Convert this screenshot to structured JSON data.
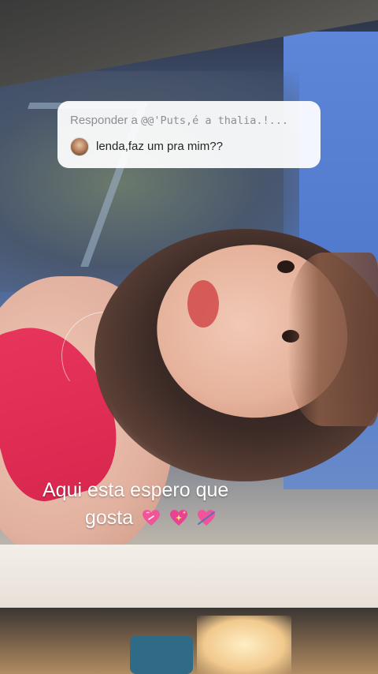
{
  "story": {
    "reply_sticker": {
      "prefix": "Responder a",
      "handle": "@@'Puts,é a thalia.!...",
      "message": "lenda,faz um pra mim??"
    },
    "caption": {
      "line1": "Aqui esta espero que",
      "line2": "gosta",
      "emojis": [
        "pink-heart-emoji",
        "sparkling-heart-emoji",
        "heart-with-arrow-emoji"
      ]
    }
  },
  "colors": {
    "sticker_bg": "#ffffff",
    "sticker_header": "#8e8e93",
    "caption_text": "#ffffff",
    "heart_pink": "#f0559a"
  }
}
